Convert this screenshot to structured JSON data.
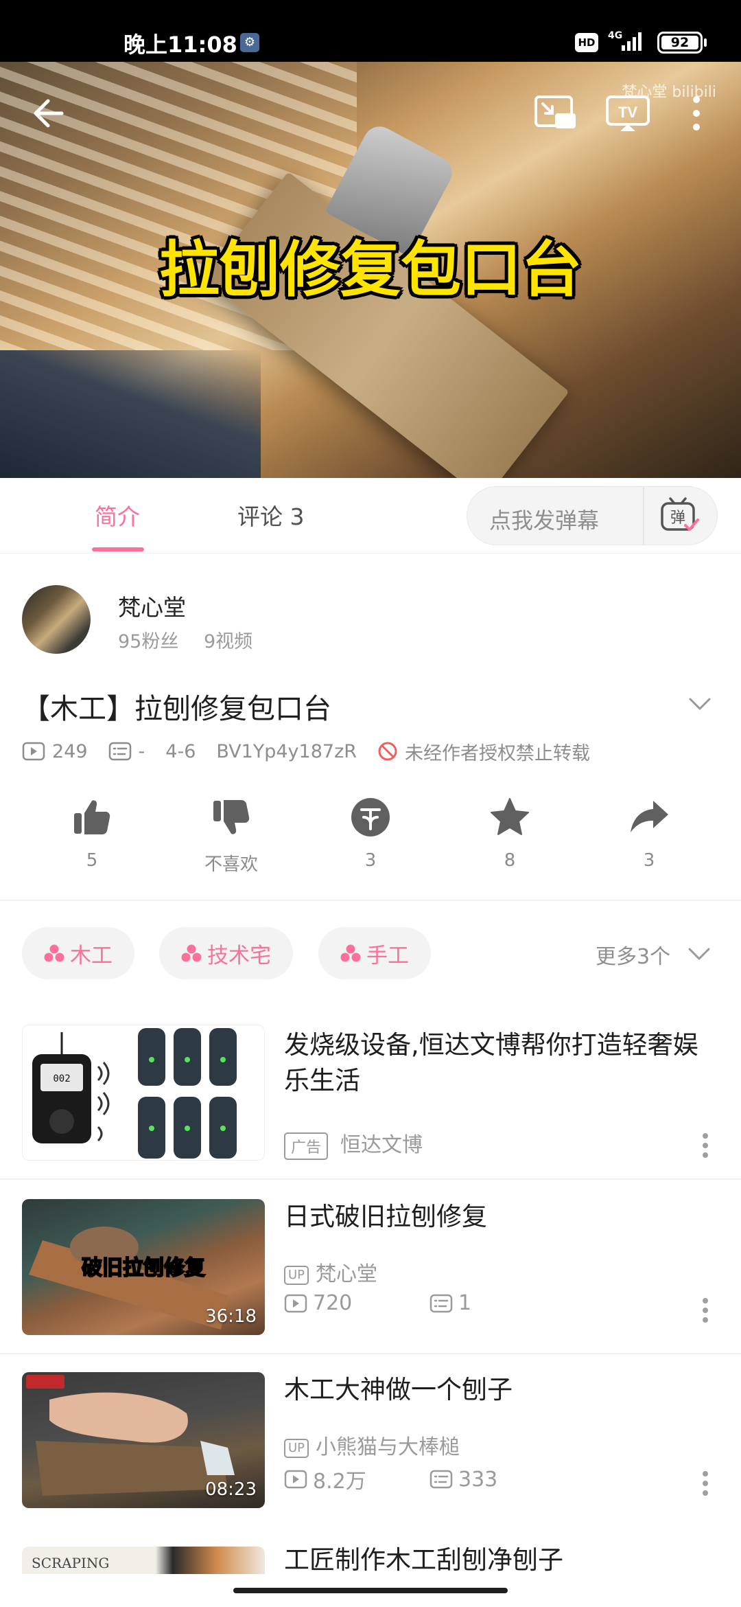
{
  "status_bar": {
    "time": "晚上11:08",
    "hd": "HD",
    "network": "4G",
    "battery": "92"
  },
  "video": {
    "overlay_title": "拉刨修复包口台",
    "watermark": "梵心堂 bilibili"
  },
  "tabs": {
    "intro": "简介",
    "comments": "评论 3",
    "danmaku_placeholder": "点我发弹幕",
    "danmaku_icon_text": "弹"
  },
  "uploader": {
    "name": "梵心堂",
    "fans": "95粉丝",
    "videos": "9视频"
  },
  "title": "【木工】拉刨修复包口台",
  "meta": {
    "plays": "249",
    "danmaku": "-",
    "date": "4-6",
    "bvid": "BV1Yp4y187zR",
    "copyright": "未经作者授权禁止转载"
  },
  "actions": {
    "like": "5",
    "dislike": "不喜欢",
    "coin": "3",
    "favorite": "8",
    "share": "3"
  },
  "tags": [
    "木工",
    "技术宅",
    "手工"
  ],
  "more_tags": "更多3个",
  "recommendations": [
    {
      "title": "发烧级设备,恒达文博帮你打造轻奢娱乐生活",
      "ad_label": "广告",
      "author": "恒达文博",
      "thumb_screen": "002"
    },
    {
      "title": "日式破旧拉刨修复",
      "up": "UP",
      "author": "梵心堂",
      "plays": "720",
      "danmaku": "1",
      "duration": "36:18",
      "thumb_text": "破旧拉刨修复"
    },
    {
      "title": "木工大神做一个刨子",
      "up": "UP",
      "author": "小熊猫与大棒槌",
      "plays": "8.2万",
      "danmaku": "333",
      "duration": "08:23"
    },
    {
      "title": "工匠制作木工刮刨净刨子",
      "thumb_text": "SCRAPING"
    }
  ],
  "colors": {
    "accent": "#fb7299",
    "status_bar_bg": "#000000",
    "overlay_title": "#ffe400"
  }
}
